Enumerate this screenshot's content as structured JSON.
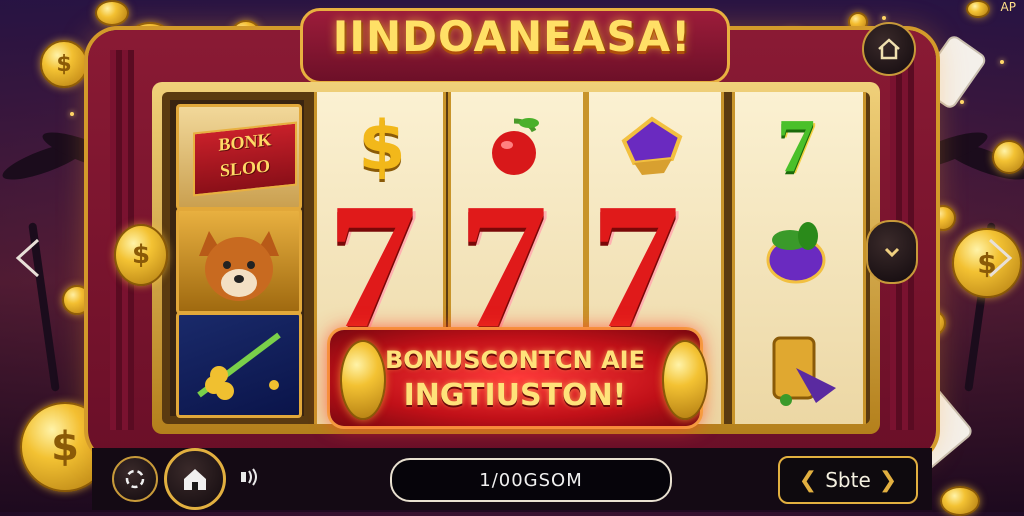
{
  "game": {
    "title": "IINDOANEASA!",
    "corner_text": "AP",
    "side_reel": {
      "label_line1": "BONK",
      "label_line2": "SLOO"
    },
    "reels": {
      "center_symbols": [
        "7",
        "7",
        "7"
      ]
    },
    "banner": {
      "line1": "BONUSCONTCN AIE",
      "line2": "INGTIUSTON!"
    },
    "bottom_bar": {
      "balance_display": "1/00GSOM",
      "action_label": "Sbte"
    },
    "icons": {
      "home_top": "home-outline-icon",
      "home_bottom": "home-icon",
      "settings": "sparkle-settings-icon",
      "sound": "sound-icon",
      "left_nav": "chevron-left-icon",
      "right_nav": "chevron-right-icon",
      "next_reel": "chevron-down-icon"
    },
    "colors": {
      "accent_gold": "#f2c04a",
      "seven_red": "#e01a1a",
      "cabinet_red": "#7a1230"
    }
  }
}
